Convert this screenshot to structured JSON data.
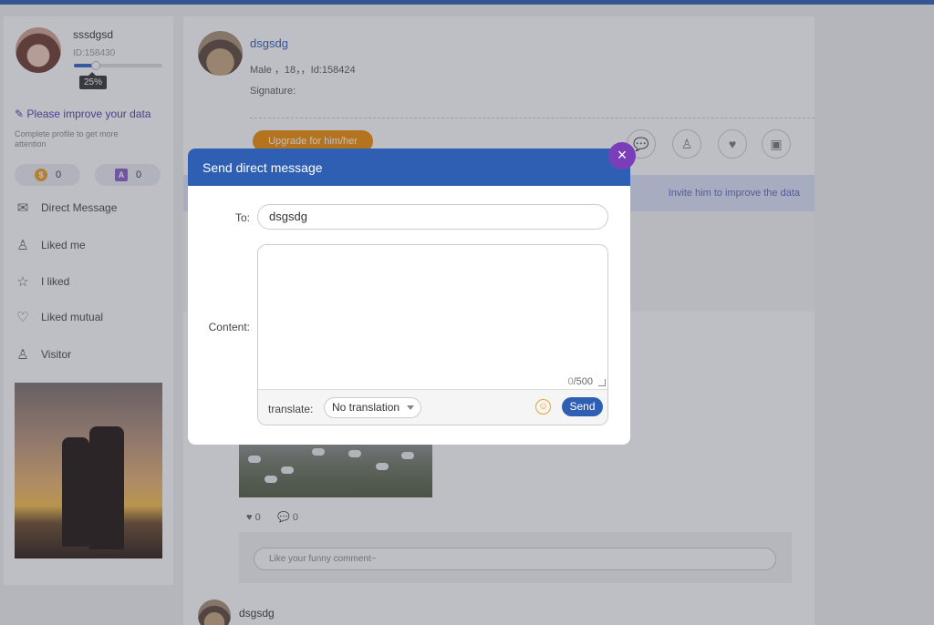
{
  "profile": {
    "name": "sssdgsd",
    "id": "ID:158430",
    "progress_percent": 25,
    "progress_label": "25%",
    "improve_link": "Please improve your data",
    "improve_sub": "Complete profile to get more attention",
    "coins": "0",
    "points": "0"
  },
  "menu": {
    "items": [
      {
        "label": "Direct Message",
        "icon": "envelope-icon"
      },
      {
        "label": "Liked me",
        "icon": "person-heart-icon"
      },
      {
        "label": "I liked",
        "icon": "star-icon"
      },
      {
        "label": "Liked mutual",
        "icon": "hearts-icon"
      },
      {
        "label": "Visitor",
        "icon": "visitor-icon"
      }
    ]
  },
  "user": {
    "name": "dsgsdg",
    "meta": "Male  ，18，，Id:158424",
    "signature": "Signature:",
    "upgrade_label": "Upgrade for him/her",
    "invite_text": "Invite him to improve the data"
  },
  "post": {
    "likes": "0",
    "comments": "0",
    "comment_placeholder": "Like your funny comment~",
    "next_author": "dsgsdg"
  },
  "modal": {
    "title": "Send direct message",
    "close": "×",
    "to_label": "To:",
    "to_value": "dsgsdg",
    "content_label": "Content:",
    "counter_current": "0",
    "counter_max": "/500",
    "translate_label": "translate:",
    "translate_value": "No translation",
    "send_label": "Send"
  },
  "colors": {
    "accent": "#2f5fb3",
    "close": "#7a3fb8",
    "upgrade": "#f08c00"
  }
}
